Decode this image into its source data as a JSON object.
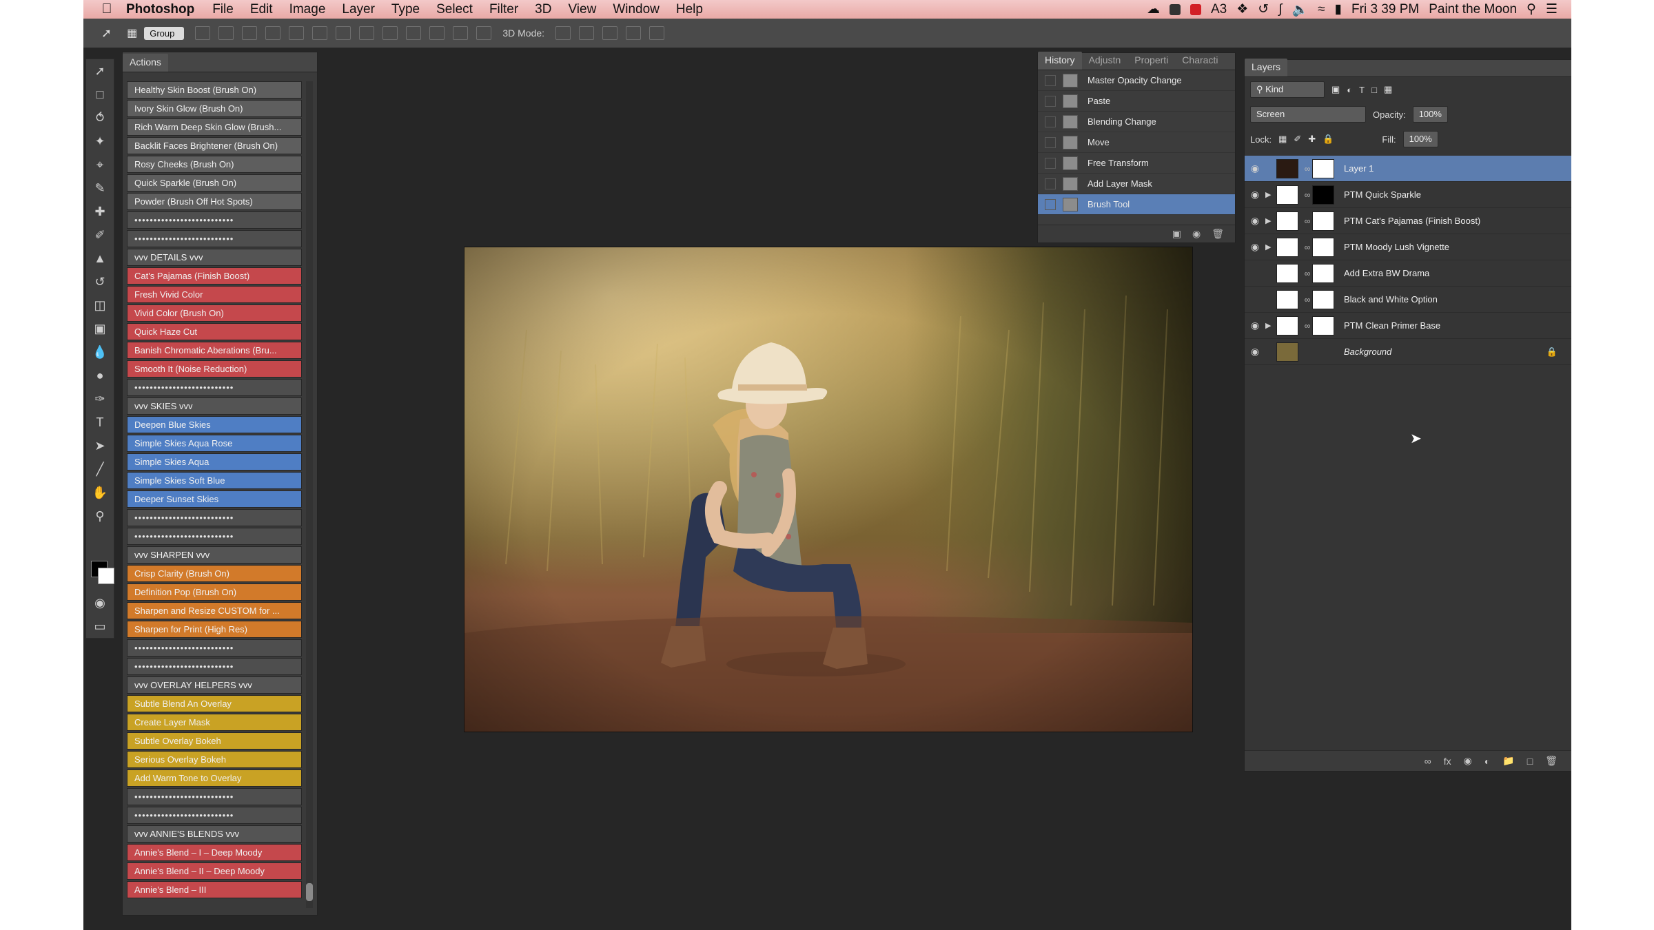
{
  "menubar": {
    "app_name": "Photoshop",
    "items": [
      "File",
      "Edit",
      "Image",
      "Layer",
      "Type",
      "Select",
      "Filter",
      "3D",
      "View",
      "Window",
      "Help"
    ],
    "clock": "Fri 3 39 PM",
    "user": "Paint the Moon",
    "status_text": "3"
  },
  "optionsbar": {
    "auto_select_value": "Group",
    "mode_3d_label": "3D Mode:"
  },
  "actions": {
    "tab": "Actions",
    "items": [
      {
        "label": "Healthy Skin Boost (Brush On)",
        "color": "gray"
      },
      {
        "label": "Ivory Skin Glow (Brush On)",
        "color": "gray"
      },
      {
        "label": "Rich Warm Deep Skin Glow (Brush...",
        "color": "gray"
      },
      {
        "label": "Backlit Faces Brightener (Brush On)",
        "color": "gray"
      },
      {
        "label": "Rosy Cheeks (Brush On)",
        "color": "gray"
      },
      {
        "label": "Quick Sparkle (Brush On)",
        "color": "gray"
      },
      {
        "label": "Powder (Brush Off Hot Spots)",
        "color": "gray"
      },
      {
        "label": "••••••••••••••••••••••••••",
        "color": "sep"
      },
      {
        "label": "••••••••••••••••••••••••••",
        "color": "sep"
      },
      {
        "label": "vvv  DETAILS vvv",
        "color": "hdr"
      },
      {
        "label": "Cat's Pajamas (Finish Boost)",
        "color": "red"
      },
      {
        "label": "Fresh Vivid Color",
        "color": "red"
      },
      {
        "label": "Vivid Color (Brush On)",
        "color": "red"
      },
      {
        "label": "Quick Haze Cut",
        "color": "red"
      },
      {
        "label": "Banish Chromatic Aberations (Bru...",
        "color": "red"
      },
      {
        "label": "Smooth It (Noise Reduction)",
        "color": "red"
      },
      {
        "label": "••••••••••••••••••••••••••",
        "color": "sep"
      },
      {
        "label": "vvv  SKIES  vvv",
        "color": "hdr"
      },
      {
        "label": "Deepen Blue Skies",
        "color": "blue"
      },
      {
        "label": "Simple Skies Aqua Rose",
        "color": "blue"
      },
      {
        "label": "Simple Skies Aqua",
        "color": "blue"
      },
      {
        "label": "Simple Skies Soft Blue",
        "color": "blue"
      },
      {
        "label": "Deeper Sunset Skies",
        "color": "blue"
      },
      {
        "label": "••••••••••••••••••••••••••",
        "color": "sep"
      },
      {
        "label": "••••••••••••••••••••••••••",
        "color": "sep"
      },
      {
        "label": "vvv  SHARPEN vvv",
        "color": "hdr"
      },
      {
        "label": "Crisp Clarity (Brush On)",
        "color": "orange"
      },
      {
        "label": "Definition Pop (Brush On)",
        "color": "orange"
      },
      {
        "label": "Sharpen and Resize CUSTOM for ...",
        "color": "orange"
      },
      {
        "label": "Sharpen for Print (High Res)",
        "color": "orange"
      },
      {
        "label": "••••••••••••••••••••••••••",
        "color": "sep"
      },
      {
        "label": "••••••••••••••••••••••••••",
        "color": "sep"
      },
      {
        "label": "vvv  OVERLAY HELPERS vvv",
        "color": "hdr"
      },
      {
        "label": "Subtle Blend An Overlay",
        "color": "yellow"
      },
      {
        "label": "Create Layer Mask",
        "color": "yellow"
      },
      {
        "label": "Subtle Overlay Bokeh",
        "color": "yellow"
      },
      {
        "label": "Serious Overlay Bokeh",
        "color": "yellow"
      },
      {
        "label": "Add Warm Tone to Overlay",
        "color": "yellow"
      },
      {
        "label": "••••••••••••••••••••••••••",
        "color": "sep"
      },
      {
        "label": "••••••••••••••••••••••••••",
        "color": "sep"
      },
      {
        "label": "vvv  ANNIE'S BLENDS vvv",
        "color": "hdr"
      },
      {
        "label": "Annie's Blend – I – Deep Moody",
        "color": "red"
      },
      {
        "label": "Annie's Blend – II – Deep Moody",
        "color": "red"
      },
      {
        "label": "Annie's Blend – III",
        "color": "red"
      }
    ]
  },
  "history": {
    "tabs": [
      "History",
      "Adjustn",
      "Properti",
      "Characti"
    ],
    "items": [
      {
        "label": "Master Opacity Change",
        "selected": false
      },
      {
        "label": "Paste",
        "selected": false
      },
      {
        "label": "Blending Change",
        "selected": false
      },
      {
        "label": "Move",
        "selected": false
      },
      {
        "label": "Free Transform",
        "selected": false
      },
      {
        "label": "Add Layer Mask",
        "selected": false
      },
      {
        "label": "Brush Tool",
        "selected": true
      }
    ]
  },
  "layers": {
    "tab": "Layers",
    "filter_kind": "Kind",
    "blend_mode": "Screen",
    "opacity_label": "Opacity:",
    "opacity_value": "100%",
    "lock_label": "Lock:",
    "fill_label": "Fill:",
    "fill_value": "100%",
    "items": [
      {
        "name": "Layer 1",
        "visible": true,
        "selected": true,
        "type": "layer"
      },
      {
        "name": "PTM Quick Sparkle",
        "visible": true,
        "selected": false,
        "type": "group"
      },
      {
        "name": "PTM Cat's Pajamas (Finish Boost)",
        "visible": true,
        "selected": false,
        "type": "group"
      },
      {
        "name": "PTM Moody Lush Vignette",
        "visible": true,
        "selected": false,
        "type": "group"
      },
      {
        "name": "Add Extra BW Drama",
        "visible": false,
        "selected": false,
        "type": "adjustment"
      },
      {
        "name": "Black and White Option",
        "visible": false,
        "selected": false,
        "type": "adjustment"
      },
      {
        "name": "PTM Clean Primer Base",
        "visible": true,
        "selected": false,
        "type": "group"
      },
      {
        "name": "Background",
        "visible": true,
        "selected": false,
        "type": "background"
      }
    ]
  },
  "colors": {
    "accent_selection": "#5c7daf",
    "action_red": "#c5484c",
    "action_blue": "#4f7ec4",
    "action_orange": "#d27a2a",
    "action_yellow": "#c9a224"
  }
}
